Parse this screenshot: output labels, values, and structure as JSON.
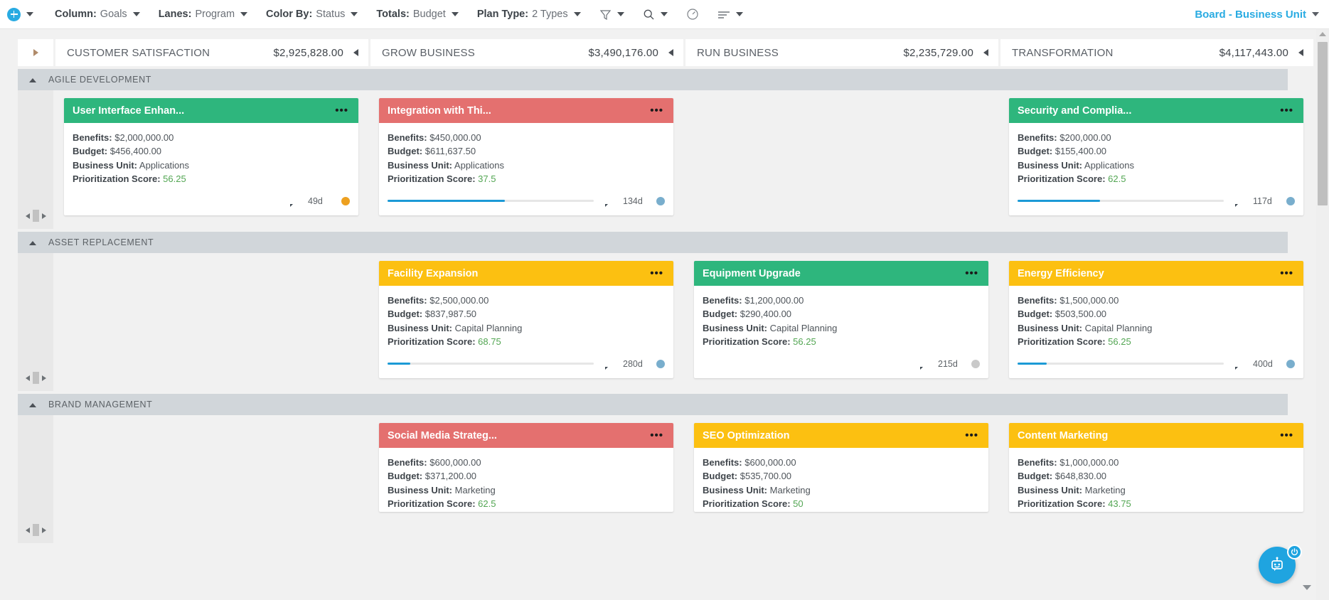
{
  "toolbar": {
    "add_label": "add-menu",
    "groups": [
      {
        "label": "Column:",
        "value": "Goals"
      },
      {
        "label": "Lanes:",
        "value": "Program"
      },
      {
        "label": "Color By:",
        "value": "Status"
      },
      {
        "label": "Totals:",
        "value": "Budget"
      },
      {
        "label": "Plan Type:",
        "value": "2 Types"
      }
    ],
    "icons": [
      "filter-icon",
      "search-icon",
      "gauge-icon",
      "list-icon"
    ],
    "board_selector": "Board - Business Unit"
  },
  "columns": [
    {
      "name": "CUSTOMER SATISFACTION",
      "total": "$2,925,828.00"
    },
    {
      "name": "GROW BUSINESS",
      "total": "$3,490,176.00"
    },
    {
      "name": "RUN BUSINESS",
      "total": "$2,235,729.00"
    },
    {
      "name": "TRANSFORMATION",
      "total": "$4,117,443.00"
    }
  ],
  "labels": {
    "benefits": "Benefits:",
    "budget": "Budget:",
    "business_unit": "Business Unit:",
    "prioritization_score": "Prioritization Score:",
    "card_menu": "•••"
  },
  "colors": {
    "green": "#2eb67d",
    "red": "#e4706f",
    "yellow": "#fcc011",
    "accent": "#29abe2",
    "progress": "#1c9ad6",
    "status_orange": "#eda020",
    "status_blue": "#79aecd",
    "status_gray": "#c9c9c9",
    "score_green": "#53a653"
  },
  "lanes": [
    {
      "name": "AGILE DEVELOPMENT",
      "cells": [
        {
          "card": {
            "title": "User Interface Enhan...",
            "color": "#2eb67d",
            "benefits": "$2,000,000.00",
            "budget": "$456,400.00",
            "business_unit": "Applications",
            "score": "56.25",
            "progress": null,
            "days": "49d",
            "status_color": "#eda020"
          }
        },
        {
          "card": {
            "title": "Integration with Thi...",
            "color": "#e4706f",
            "benefits": "$450,000.00",
            "budget": "$611,637.50",
            "business_unit": "Applications",
            "score": "37.5",
            "progress": 57,
            "days": "134d",
            "status_color": "#79aecd"
          }
        },
        {
          "card": null
        },
        {
          "card": {
            "title": "Security and Complia...",
            "color": "#2eb67d",
            "benefits": "$200,000.00",
            "budget": "$155,400.00",
            "business_unit": "Applications",
            "score": "62.5",
            "progress": 40,
            "days": "117d",
            "status_color": "#79aecd"
          }
        }
      ]
    },
    {
      "name": "ASSET REPLACEMENT",
      "cells": [
        {
          "card": null
        },
        {
          "card": {
            "title": "Facility Expansion",
            "color": "#fcc011",
            "benefits": "$2,500,000.00",
            "budget": "$837,987.50",
            "business_unit": "Capital Planning",
            "score": "68.75",
            "progress": 11,
            "days": "280d",
            "status_color": "#79aecd"
          }
        },
        {
          "card": {
            "title": "Equipment Upgrade",
            "color": "#2eb67d",
            "benefits": "$1,200,000.00",
            "budget": "$290,400.00",
            "business_unit": "Capital Planning",
            "score": "56.25",
            "progress": null,
            "days": "215d",
            "status_color": "#c9c9c9"
          }
        },
        {
          "card": {
            "title": "Energy Efficiency",
            "color": "#fcc011",
            "benefits": "$1,500,000.00",
            "budget": "$503,500.00",
            "business_unit": "Capital Planning",
            "score": "56.25",
            "progress": 14,
            "days": "400d",
            "status_color": "#79aecd"
          }
        }
      ]
    },
    {
      "name": "BRAND MANAGEMENT",
      "cells": [
        {
          "card": null
        },
        {
          "card": {
            "title": "Social Media Strateg...",
            "color": "#e4706f",
            "benefits": "$600,000.00",
            "budget": "$371,200.00",
            "business_unit": "Marketing",
            "score": "62.5",
            "progress": null,
            "days": "",
            "status_color": ""
          }
        },
        {
          "card": {
            "title": "SEO Optimization",
            "color": "#fcc011",
            "benefits": "$600,000.00",
            "budget": "$535,700.00",
            "business_unit": "Marketing",
            "score": "50",
            "progress": null,
            "days": "",
            "status_color": ""
          }
        },
        {
          "card": {
            "title": "Content Marketing",
            "color": "#fcc011",
            "benefits": "$1,000,000.00",
            "budget": "$648,830.00",
            "business_unit": "Marketing",
            "score": "43.75",
            "progress": null,
            "days": "",
            "status_color": ""
          }
        }
      ]
    }
  ]
}
